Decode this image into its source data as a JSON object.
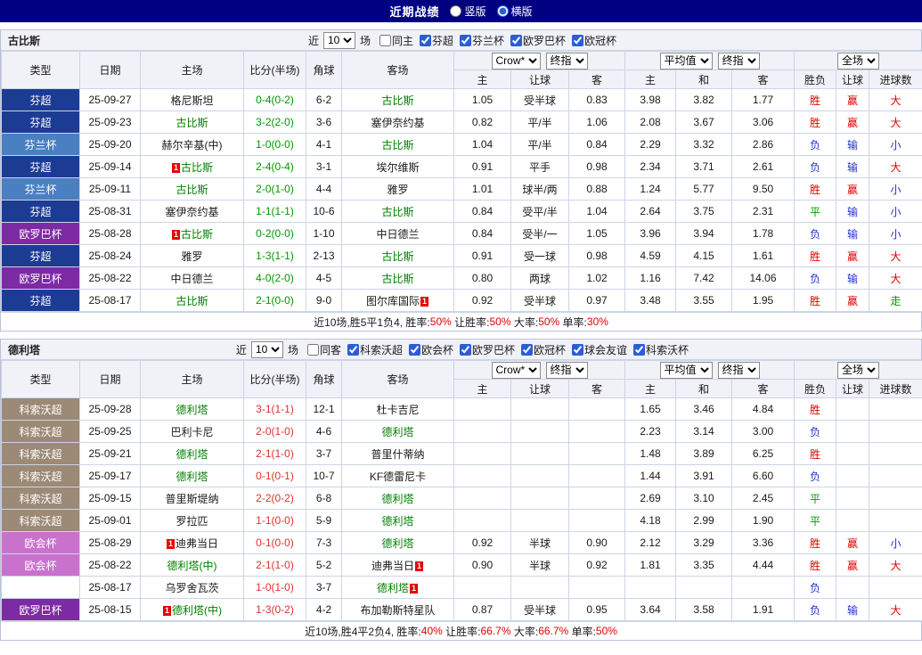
{
  "topbar": {
    "title": "近期战绩",
    "radio_vertical": "竖版",
    "radio_horizontal": "横版",
    "vertical_checked": false,
    "horizontal_checked": true
  },
  "columns": {
    "left": [
      "类型",
      "日期",
      "主场",
      "比分(半场)",
      "角球",
      "客场"
    ],
    "odds_sub": [
      "主",
      "让球",
      "客"
    ],
    "avg_sub": [
      "主",
      "和",
      "客"
    ],
    "full_sub": [
      "胜负",
      "让球",
      "进球数"
    ]
  },
  "badge_text": "1",
  "colors": {
    "topbar_bg": "#000080",
    "focal_team": "#008000",
    "score_green": "#009900",
    "score_red": "#dd3333",
    "summary_red": "#e00000",
    "badge_bg": "#e60000",
    "type_bg": {
      "芬超": "#1c3c94",
      "芬兰杯": "#4a7fc1",
      "欧罗巴杯": "#7d2aa5",
      "科索沃超": "#9c8a76",
      "欧会杯": "#c972cd",
      "": "#ffffff"
    },
    "result": {
      "胜": "#e00000",
      "赢": "#e00000",
      "大": "#e00000",
      "负": "#2233cc",
      "输": "#2233cc",
      "小": "#2233cc",
      "平": "#009900",
      "走": "#009900"
    }
  },
  "sections": [
    {
      "team": "古比斯",
      "filter": {
        "prefix": "近",
        "count": "10",
        "suffix": "场",
        "checkboxes": [
          {
            "label": "同主",
            "checked": false
          },
          {
            "label": "芬超",
            "checked": true
          },
          {
            "label": "芬兰杯",
            "checked": true
          },
          {
            "label": "欧罗巴杯",
            "checked": true
          },
          {
            "label": "欧冠杯",
            "checked": true
          }
        ]
      },
      "selects": {
        "provider": "Crow*",
        "provider_kind": "终指",
        "avg": "平均值",
        "avg_kind": "终指",
        "scope": "全场"
      },
      "rows": [
        {
          "type": "芬超",
          "date": "25-09-27",
          "home": "格尼斯坦",
          "away": "古比斯",
          "away_focal": true,
          "score": "0-4(0-2)",
          "score_color": "green",
          "corner": "6-2",
          "odds": [
            "1.05",
            "受半球",
            "0.83"
          ],
          "avg": [
            "3.98",
            "3.82",
            "1.77"
          ],
          "results": [
            "胜",
            "赢",
            "大"
          ]
        },
        {
          "type": "芬超",
          "date": "25-09-23",
          "home": "古比斯",
          "home_focal": true,
          "away": "塞伊奈约基",
          "score": "3-2(2-0)",
          "score_color": "green",
          "corner": "3-6",
          "odds": [
            "0.82",
            "平/半",
            "1.06"
          ],
          "avg": [
            "2.08",
            "3.67",
            "3.06"
          ],
          "results": [
            "胜",
            "赢",
            "大"
          ]
        },
        {
          "type": "芬兰杯",
          "date": "25-09-20",
          "home": "赫尔辛基(中)",
          "away": "古比斯",
          "away_focal": true,
          "score": "1-0(0-0)",
          "score_color": "green",
          "corner": "4-1",
          "odds": [
            "1.04",
            "平/半",
            "0.84"
          ],
          "avg": [
            "2.29",
            "3.32",
            "2.86"
          ],
          "results": [
            "负",
            "输",
            "小"
          ]
        },
        {
          "type": "芬超",
          "date": "25-09-14",
          "home": "古比斯",
          "home_focal": true,
          "home_badge": "pre",
          "away": "埃尔维斯",
          "score": "2-4(0-4)",
          "score_color": "green",
          "corner": "3-1",
          "odds": [
            "0.91",
            "平手",
            "0.98"
          ],
          "avg": [
            "2.34",
            "3.71",
            "2.61"
          ],
          "results": [
            "负",
            "输",
            "大"
          ]
        },
        {
          "type": "芬兰杯",
          "date": "25-09-11",
          "home": "古比斯",
          "home_focal": true,
          "away": "雅罗",
          "score": "2-0(1-0)",
          "score_color": "green",
          "corner": "4-4",
          "odds": [
            "1.01",
            "球半/两",
            "0.88"
          ],
          "avg": [
            "1.24",
            "5.77",
            "9.50"
          ],
          "results": [
            "胜",
            "赢",
            "小"
          ]
        },
        {
          "type": "芬超",
          "date": "25-08-31",
          "home": "塞伊奈约基",
          "away": "古比斯",
          "away_focal": true,
          "score": "1-1(1-1)",
          "score_color": "green",
          "corner": "10-6",
          "odds": [
            "0.84",
            "受平/半",
            "1.04"
          ],
          "avg": [
            "2.64",
            "3.75",
            "2.31"
          ],
          "results": [
            "平",
            "输",
            "小"
          ]
        },
        {
          "type": "欧罗巴杯",
          "date": "25-08-28",
          "home": "古比斯",
          "home_focal": true,
          "home_badge": "pre",
          "away": "中日德兰",
          "score": "0-2(0-0)",
          "score_color": "green",
          "corner": "1-10",
          "odds": [
            "0.84",
            "受半/一",
            "1.05"
          ],
          "avg": [
            "3.96",
            "3.94",
            "1.78"
          ],
          "results": [
            "负",
            "输",
            "小"
          ]
        },
        {
          "type": "芬超",
          "date": "25-08-24",
          "home": "雅罗",
          "away": "古比斯",
          "away_focal": true,
          "score": "1-3(1-1)",
          "score_color": "green",
          "corner": "2-13",
          "odds": [
            "0.91",
            "受一球",
            "0.98"
          ],
          "avg": [
            "4.59",
            "4.15",
            "1.61"
          ],
          "results": [
            "胜",
            "赢",
            "大"
          ]
        },
        {
          "type": "欧罗巴杯",
          "date": "25-08-22",
          "home": "中日德兰",
          "away": "古比斯",
          "away_focal": true,
          "score": "4-0(2-0)",
          "score_color": "green",
          "corner": "4-5",
          "odds": [
            "0.80",
            "两球",
            "1.02"
          ],
          "avg": [
            "1.16",
            "7.42",
            "14.06"
          ],
          "results": [
            "负",
            "输",
            "大"
          ]
        },
        {
          "type": "芬超",
          "date": "25-08-17",
          "home": "古比斯",
          "home_focal": true,
          "away": "图尔库国际",
          "away_badge": "post",
          "score": "2-1(0-0)",
          "score_color": "green",
          "corner": "9-0",
          "odds": [
            "0.92",
            "受半球",
            "0.97"
          ],
          "avg": [
            "3.48",
            "3.55",
            "1.95"
          ],
          "results": [
            "胜",
            "赢",
            "走"
          ]
        }
      ],
      "summary": [
        {
          "text": "近10场,胜5平1负4, 胜率:",
          "red": false
        },
        {
          "text": "50%",
          "red": true
        },
        {
          "text": " 让胜率:",
          "red": false
        },
        {
          "text": "50%",
          "red": true
        },
        {
          "text": " 大率:",
          "red": false
        },
        {
          "text": "50%",
          "red": true
        },
        {
          "text": " 单率:",
          "red": false
        },
        {
          "text": "30%",
          "red": true
        }
      ]
    },
    {
      "team": "德利塔",
      "filter": {
        "prefix": "近",
        "count": "10",
        "suffix": "场",
        "checkboxes": [
          {
            "label": "同客",
            "checked": false
          },
          {
            "label": "科索沃超",
            "checked": true
          },
          {
            "label": "欧会杯",
            "checked": true
          },
          {
            "label": "欧罗巴杯",
            "checked": true
          },
          {
            "label": "欧冠杯",
            "checked": true
          },
          {
            "label": "球会友谊",
            "checked": true
          },
          {
            "label": "科索沃杯",
            "checked": true
          }
        ]
      },
      "selects": {
        "provider": "Crow*",
        "provider_kind": "终指",
        "avg": "平均值",
        "avg_kind": "终指",
        "scope": "全场"
      },
      "rows": [
        {
          "type": "科索沃超",
          "date": "25-09-28",
          "home": "德利塔",
          "home_focal": true,
          "away": "杜卡吉尼",
          "score": "3-1(1-1)",
          "score_color": "red",
          "corner": "12-1",
          "odds": [
            "",
            "",
            ""
          ],
          "avg": [
            "1.65",
            "3.46",
            "4.84"
          ],
          "results": [
            "胜",
            "",
            ""
          ]
        },
        {
          "type": "科索沃超",
          "date": "25-09-25",
          "home": "巴利卡尼",
          "away": "德利塔",
          "away_focal": true,
          "score": "2-0(1-0)",
          "score_color": "red",
          "corner": "4-6",
          "odds": [
            "",
            "",
            ""
          ],
          "avg": [
            "2.23",
            "3.14",
            "3.00"
          ],
          "results": [
            "负",
            "",
            ""
          ]
        },
        {
          "type": "科索沃超",
          "date": "25-09-21",
          "home": "德利塔",
          "home_focal": true,
          "away": "普里什蒂纳",
          "score": "2-1(1-0)",
          "score_color": "red",
          "corner": "3-7",
          "odds": [
            "",
            "",
            ""
          ],
          "avg": [
            "1.48",
            "3.89",
            "6.25"
          ],
          "results": [
            "胜",
            "",
            ""
          ]
        },
        {
          "type": "科索沃超",
          "date": "25-09-17",
          "home": "德利塔",
          "home_focal": true,
          "away": "KF德雷尼卡",
          "score": "0-1(0-1)",
          "score_color": "red",
          "corner": "10-7",
          "odds": [
            "",
            "",
            ""
          ],
          "avg": [
            "1.44",
            "3.91",
            "6.60"
          ],
          "results": [
            "负",
            "",
            ""
          ]
        },
        {
          "type": "科索沃超",
          "date": "25-09-15",
          "home": "普里斯堤纳",
          "away": "德利塔",
          "away_focal": true,
          "score": "2-2(0-2)",
          "score_color": "red",
          "corner": "6-8",
          "odds": [
            "",
            "",
            ""
          ],
          "avg": [
            "2.69",
            "3.10",
            "2.45"
          ],
          "results": [
            "平",
            "",
            ""
          ]
        },
        {
          "type": "科索沃超",
          "date": "25-09-01",
          "home": "罗拉匹",
          "away": "德利塔",
          "away_focal": true,
          "score": "1-1(0-0)",
          "score_color": "red",
          "corner": "5-9",
          "odds": [
            "",
            "",
            ""
          ],
          "avg": [
            "4.18",
            "2.99",
            "1.90"
          ],
          "results": [
            "平",
            "",
            ""
          ]
        },
        {
          "type": "欧会杯",
          "date": "25-08-29",
          "home": "迪弗当日",
          "home_badge": "pre",
          "away": "德利塔",
          "away_focal": true,
          "score": "0-1(0-0)",
          "score_color": "red",
          "corner": "7-3",
          "odds": [
            "0.92",
            "半球",
            "0.90"
          ],
          "avg": [
            "2.12",
            "3.29",
            "3.36"
          ],
          "results": [
            "胜",
            "赢",
            "小"
          ]
        },
        {
          "type": "欧会杯",
          "date": "25-08-22",
          "home": "德利塔(中)",
          "home_focal": true,
          "away": "迪弗当日",
          "away_badge": "post",
          "score": "2-1(1-0)",
          "score_color": "red",
          "corner": "5-2",
          "odds": [
            "0.90",
            "半球",
            "0.92"
          ],
          "avg": [
            "1.81",
            "3.35",
            "4.44"
          ],
          "results": [
            "胜",
            "赢",
            "大"
          ]
        },
        {
          "type": "",
          "date": "25-08-17",
          "home": "乌罗舍瓦茨",
          "away": "德利塔",
          "away_focal": true,
          "away_badge": "post",
          "score": "1-0(1-0)",
          "score_color": "red",
          "corner": "3-7",
          "odds": [
            "",
            "",
            ""
          ],
          "avg": [
            "",
            "",
            ""
          ],
          "results": [
            "负",
            "",
            ""
          ]
        },
        {
          "type": "欧罗巴杯",
          "date": "25-08-15",
          "home": "德利塔(中)",
          "home_focal": true,
          "home_badge": "pre",
          "away": "布加勒斯特星队",
          "score": "1-3(0-2)",
          "score_color": "red",
          "corner": "4-2",
          "odds": [
            "0.87",
            "受半球",
            "0.95"
          ],
          "avg": [
            "3.64",
            "3.58",
            "1.91"
          ],
          "results": [
            "负",
            "输",
            "大"
          ]
        }
      ],
      "summary": [
        {
          "text": "近10场,胜4平2负4, 胜率:",
          "red": false
        },
        {
          "text": "40%",
          "red": true
        },
        {
          "text": " 让胜率:",
          "red": false
        },
        {
          "text": "66.7%",
          "red": true
        },
        {
          "text": " 大率:",
          "red": false
        },
        {
          "text": "66.7%",
          "red": true
        },
        {
          "text": " 单率:",
          "red": false
        },
        {
          "text": "50%",
          "red": true
        }
      ]
    }
  ]
}
